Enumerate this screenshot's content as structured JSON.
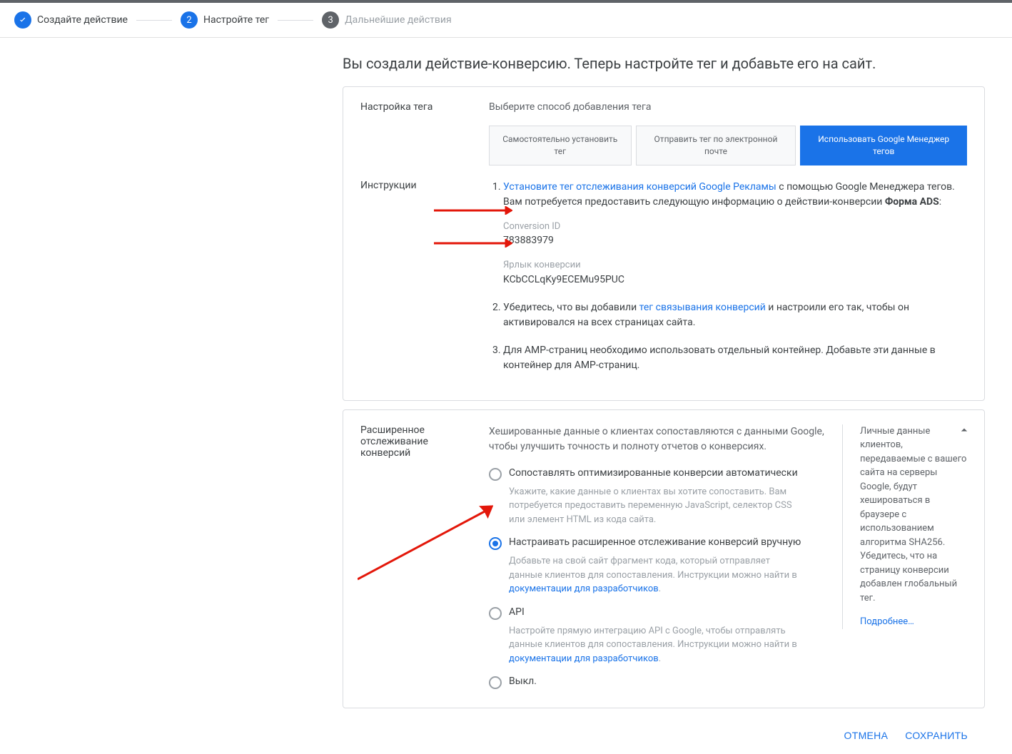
{
  "stepper": {
    "step1": {
      "label": "Создайте действие"
    },
    "step2": {
      "num": "2",
      "label": "Настройте тег"
    },
    "step3": {
      "num": "3",
      "label": "Дальнейшие действия"
    }
  },
  "page_title": "Вы создали действие-конверсию. Теперь настройте тег и добавьте его на сайт.",
  "card_setup": {
    "label": "Настройка тега",
    "desc": "Выберите способ добавления тега",
    "tabs": {
      "self": "Самостоятельно установить тег",
      "email": "Отправить тег по электронной почте",
      "gtm": "Использовать Google Менеджер тегов"
    },
    "instructions_label": "Инструкции",
    "instr1": {
      "link": "Установите тег отслеживания конверсий Google Рекламы",
      "tail": " с помощью Google Менеджера тегов. Вам потребуется предоставить следующую информацию о действии-конверсии ",
      "action_name": "Форма ADS",
      "conv_id_label": "Conversion ID",
      "conv_id_value": "783883979",
      "conv_tag_label": "Ярлык конверсии",
      "conv_tag_value": "KCbCCLqKy9ECEMu95PUC"
    },
    "instr2": {
      "pre": "Убедитесь, что вы добавили ",
      "link": "тег связывания конверсий",
      "post": " и настроили его так, чтобы он активировался на всех страницах сайта."
    },
    "instr3": "Для AMP-страниц необходимо использовать отдельный контейнер. Добавьте эти данные в контейнер для AMP-страниц."
  },
  "card_enh": {
    "label": "Расширенное отслеживание конверсий",
    "desc": "Хешированные данные о клиентах сопоставляются с данными Google, чтобы улучшить точность и полноту отчетов о конверсиях.",
    "opt_auto": {
      "label": "Сопоставлять оптимизированные конверсии автоматически",
      "desc": "Укажите, какие данные о клиентах вы хотите сопоставить. Вам потребуется предоставить переменную JavaScript, селектор CSS или элемент HTML из кода сайта."
    },
    "opt_manual": {
      "label": "Настраивать расширенное отслеживание конверсий вручную",
      "desc_pre": "Добавьте на свой сайт фрагмент кода, который отправляет данные клиентов для сопоставления. Инструкции можно найти в ",
      "desc_link": "документации для разработчиков"
    },
    "opt_api": {
      "label": "API",
      "desc_pre": "Настройте прямую интеграцию API с Google, чтобы отправлять данные клиентов для сопоставления. Инструкции можно найти в ",
      "desc_link": "документации для разработчиков"
    },
    "opt_off": {
      "label": "Выкл."
    },
    "infobox": {
      "text": "Личные данные клиентов, передаваемые с вашего сайта на серверы Google, будут хешироваться в браузере с использованием алгоритма SHA256. Убедитесь, что на страницу конверсии добавлен глобальный тег.",
      "link": "Подробнее…"
    }
  },
  "footer": {
    "cancel": "ОТМЕНА",
    "save": "СОХРАНИТЬ"
  }
}
